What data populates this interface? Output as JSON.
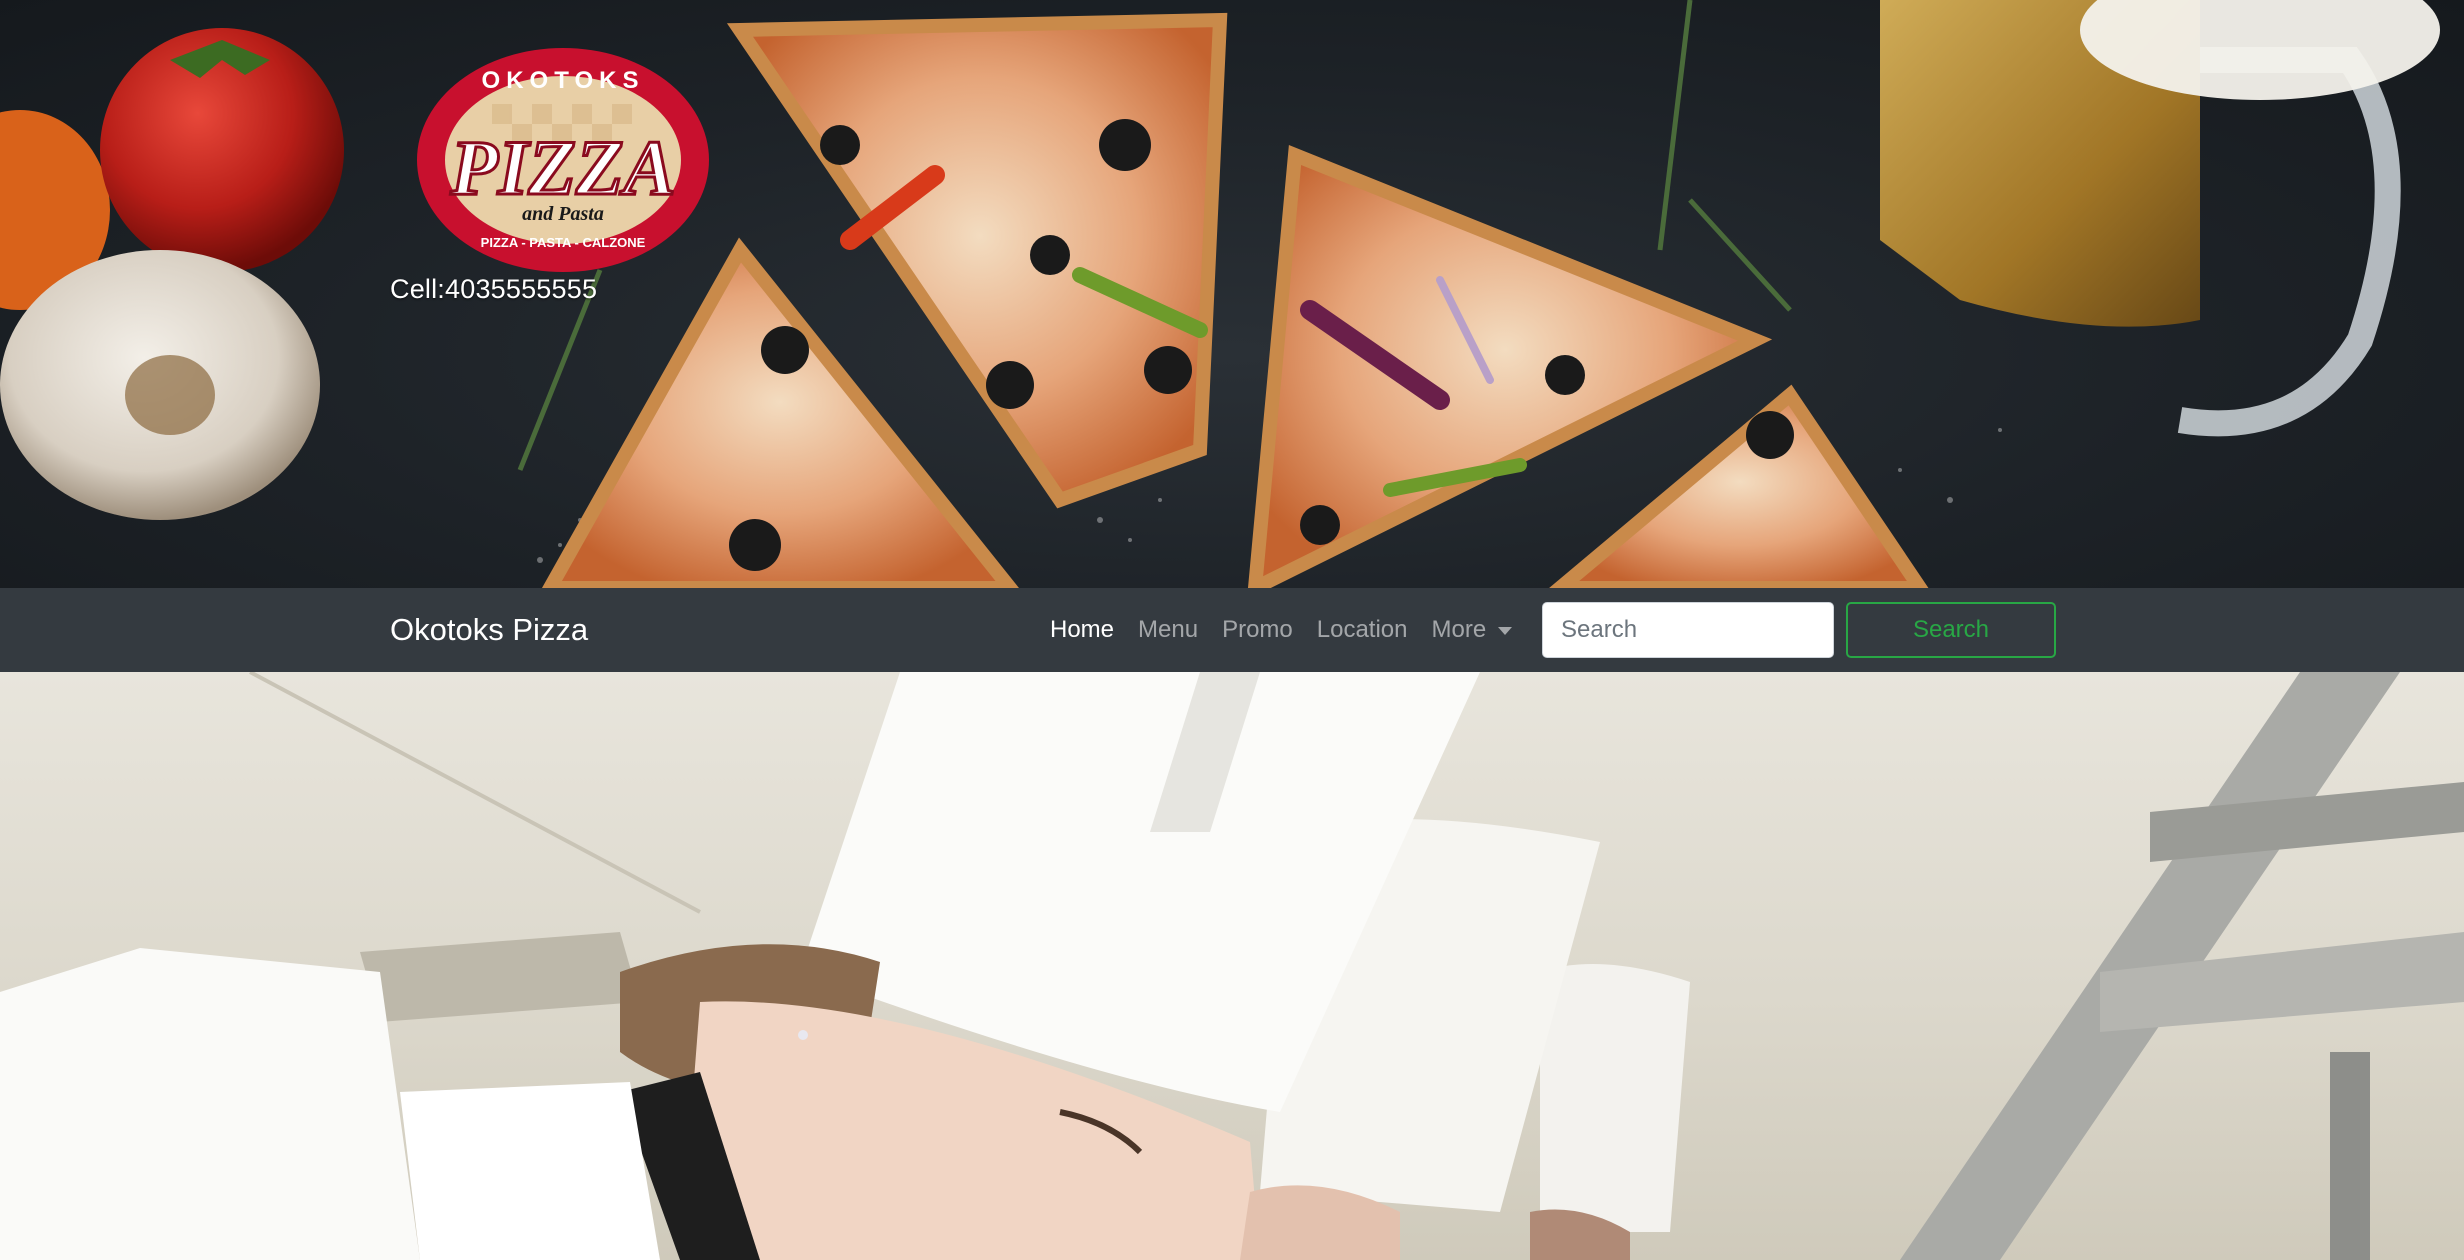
{
  "header": {
    "logo": {
      "alt": "Okotoks Pizza and Pasta logo",
      "top_text": "OKOTOKS",
      "main_text": "PIZZA",
      "sub_text": "and Pasta",
      "bottom_text": "PIZZA - PASTA - CALZONE"
    },
    "cell": "Cell:4035555555",
    "hero_image": "pizza-slices-photo"
  },
  "navbar": {
    "brand": "Okotoks Pizza",
    "links": [
      {
        "label": "Home",
        "active": true
      },
      {
        "label": "Menu",
        "active": false
      },
      {
        "label": "Promo",
        "active": false
      },
      {
        "label": "Location",
        "active": false
      },
      {
        "label": "More",
        "active": false,
        "dropdown": true
      }
    ],
    "search": {
      "placeholder": "Search",
      "button_label": "Search"
    }
  },
  "banner": {
    "image": "chefs-in-kitchen-photo"
  },
  "colors": {
    "navbar_bg": "#343a40",
    "search_accent": "#28a745",
    "logo_red": "#c8102e"
  }
}
